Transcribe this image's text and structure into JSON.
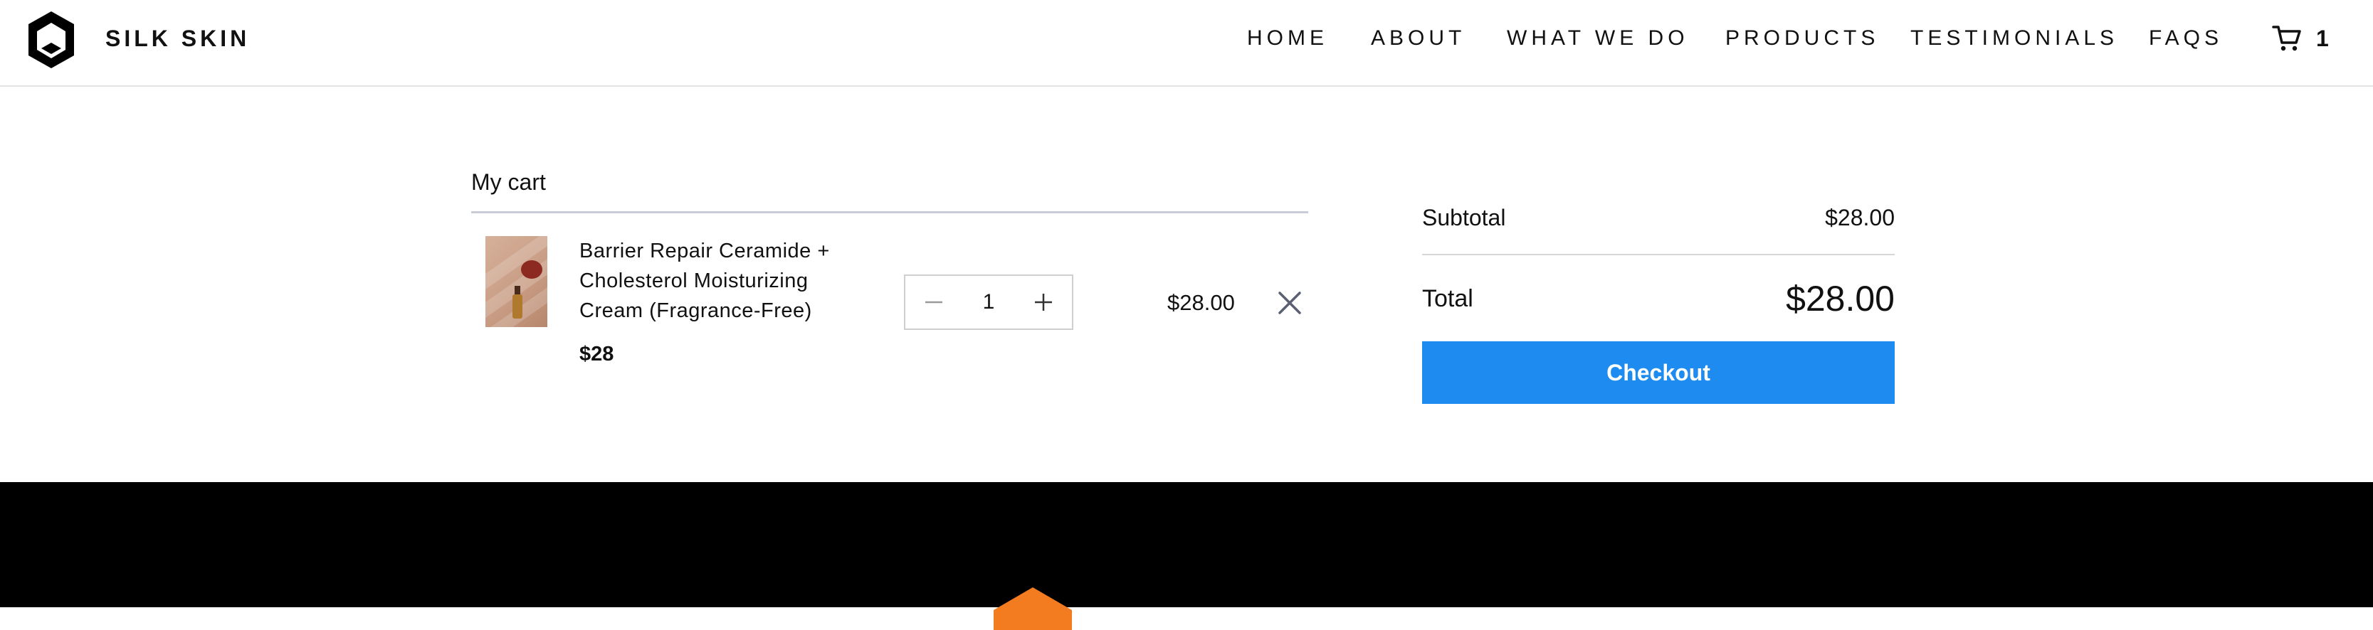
{
  "brand": {
    "name": "SILK SKIN",
    "logo_icon": "hexagon-logo-icon"
  },
  "nav": {
    "items": [
      "HOME",
      "ABOUT",
      "WHAT WE DO",
      "PRODUCTS",
      "TESTIMONIALS",
      "FAQS"
    ],
    "cart_icon": "shopping-cart-icon",
    "cart_count": "1"
  },
  "cart": {
    "title": "My cart",
    "items": [
      {
        "name": "Barrier Repair Ceramide + Cholesterol Moisturizing Cream (Fragrance-Free)",
        "unit_price": "$28",
        "quantity": "1",
        "line_price": "$28.00"
      }
    ]
  },
  "summary": {
    "subtotal_label": "Subtotal",
    "subtotal_value": "$28.00",
    "total_label": "Total",
    "total_value": "$28.00",
    "checkout_label": "Checkout"
  },
  "colors": {
    "accent": "#1e8bf0",
    "footer_bg": "#000000",
    "footer_logo": "#f47c20",
    "divider": "#c9cbd6"
  }
}
